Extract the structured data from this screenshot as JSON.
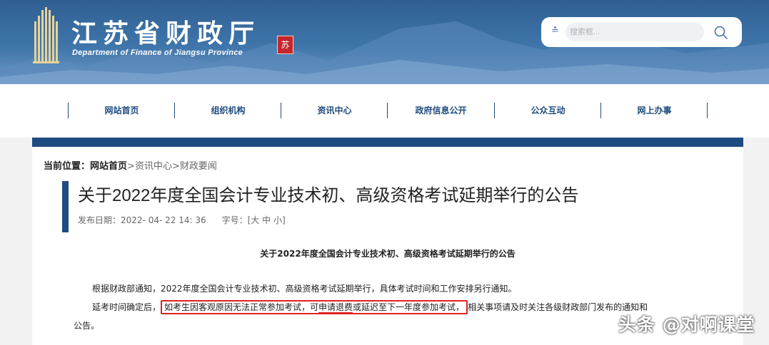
{
  "header": {
    "title": "江苏省财政厅",
    "subtitle": "Department of Finance of Jiangsu Province",
    "seal_text": "苏",
    "search": {
      "placeholder": "搜索框..."
    }
  },
  "nav": {
    "items": [
      {
        "label": "网站首页"
      },
      {
        "label": "组织机构"
      },
      {
        "label": "资讯中心"
      },
      {
        "label": "政府信息公开"
      },
      {
        "label": "公众互动"
      },
      {
        "label": "网上办事"
      }
    ]
  },
  "breadcrumb": {
    "prefix": "当前位置：",
    "home": "网站首页",
    "sep": ">",
    "section": "资讯中心",
    "current": "财政要闻"
  },
  "article": {
    "title": "关于2022年度全国会计专业技术初、高级资格考试延期举行的公告",
    "date_label": "发布日期：",
    "date": "2022- 04- 22  14: 36",
    "size_label": "字号：[",
    "size_large": "大",
    "size_medium": "中",
    "size_small": "小",
    "size_close": "]",
    "content_title": "关于2022年度全国会计专业技术初、高级资格考试延期举行的公告",
    "para1": "根据财政部通知，2022年度全国会计专业技术初、高级资格考试延期举行，具体考试时间和工作安排另行通知。",
    "para2_start": "延考时间确定后，",
    "para2_hl_a": "如考生因客观原因无法正常参加考试，可",
    "para2_hl_ul": "申请退费",
    "para2_hl_b": "或延迟至下一年度参加考试，",
    "para2_end": "相关事项请及时关注各级财政部门发布的通知和",
    "para3": "公告。"
  },
  "watermark": "头条 @对啊课堂",
  "colors": {
    "brand": "#1f4c80",
    "highlight": "#e02020",
    "seal": "#c5262b"
  }
}
